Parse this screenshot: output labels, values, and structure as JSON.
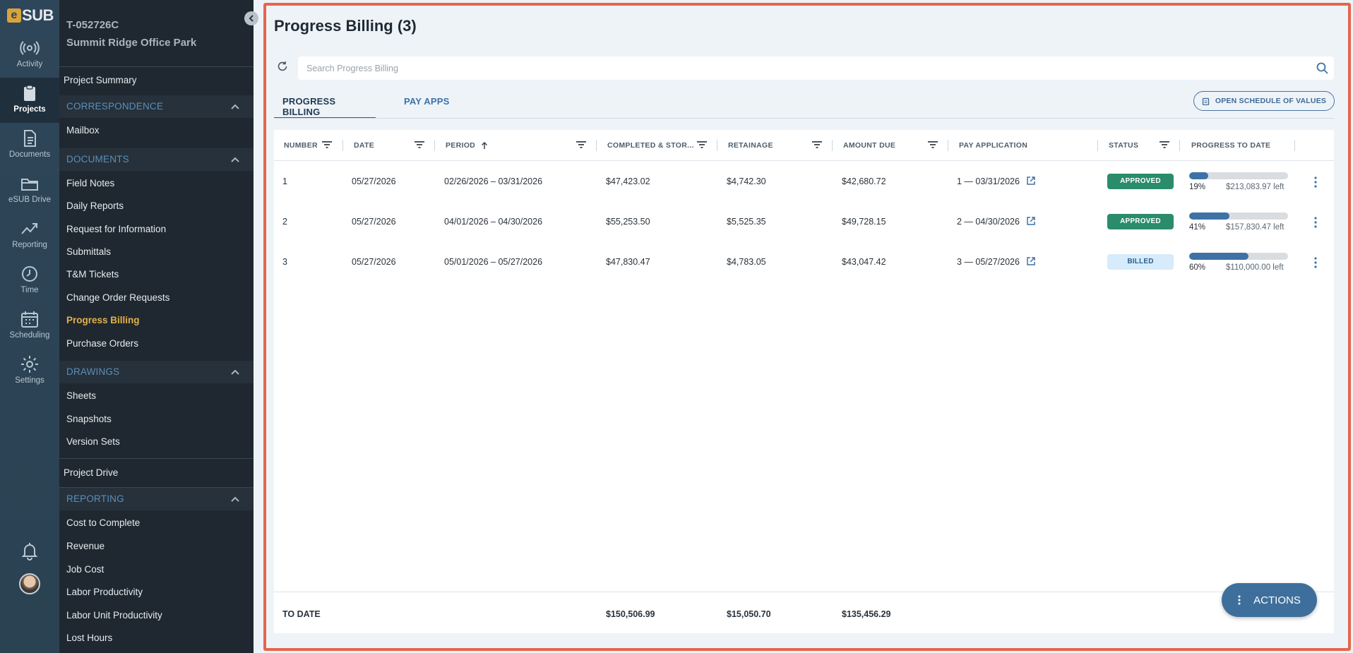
{
  "rail": {
    "logo_text": "SUB",
    "logo_mark": "e",
    "items": [
      {
        "label": "Activity",
        "icon": "activity-icon"
      },
      {
        "label": "Projects",
        "icon": "clipboard-icon"
      },
      {
        "label": "Documents",
        "icon": "document-icon"
      },
      {
        "label": "eSUB Drive",
        "icon": "folder-icon"
      },
      {
        "label": "Reporting",
        "icon": "chart-icon"
      },
      {
        "label": "Time",
        "icon": "clock-icon"
      },
      {
        "label": "Scheduling",
        "icon": "calendar-icon"
      },
      {
        "label": "Settings",
        "icon": "gear-icon"
      }
    ]
  },
  "project": {
    "id": "T-052726C",
    "name": "Summit Ridge Office Park"
  },
  "nav": {
    "project_summary": "Project Summary",
    "correspondence": "CORRESPONDENCE",
    "mailbox": "Mailbox",
    "documents": "DOCUMENTS",
    "doc_items": [
      "Field Notes",
      "Daily Reports",
      "Request for Information",
      "Submittals",
      "T&M Tickets",
      "Change Order Requests",
      "Progress Billing",
      "Purchase Orders"
    ],
    "drawings": "DRAWINGS",
    "drawing_items": [
      "Sheets",
      "Snapshots",
      "Version Sets"
    ],
    "project_drive": "Project Drive",
    "reporting": "REPORTING",
    "report_items": [
      "Cost to Complete",
      "Revenue",
      "Job Cost",
      "Labor Productivity",
      "Labor Unit Productivity",
      "Lost Hours"
    ]
  },
  "page": {
    "title": "Progress Billing (3)",
    "search_placeholder": "Search Progress Billing",
    "tab_progress_billing": "PROGRESS BILLING",
    "tab_pay_apps": "PAY APPS",
    "sov_button": "OPEN SCHEDULE OF VALUES",
    "actions_button": "ACTIONS"
  },
  "table": {
    "headers": {
      "number": "NUMBER",
      "date": "DATE",
      "period": "PERIOD",
      "completed": "COMPLETED & STOR...",
      "retainage": "RETAINAGE",
      "amount_due": "AMOUNT DUE",
      "pay_application": "PAY APPLICATION",
      "status": "STATUS",
      "progress": "PROGRESS TO DATE"
    },
    "rows": [
      {
        "number": "1",
        "date": "05/27/2026",
        "period": "02/26/2026 – 03/31/2026",
        "completed": "$47,423.02",
        "retainage": "$4,742.30",
        "amount_due": "$42,680.72",
        "pay_application": "1 — 03/31/2026",
        "status": "APPROVED",
        "progress_pct": "19%",
        "progress_value": 0.19,
        "left": "$213,083.97 left"
      },
      {
        "number": "2",
        "date": "05/27/2026",
        "period": "04/01/2026 – 04/30/2026",
        "completed": "$55,253.50",
        "retainage": "$5,525.35",
        "amount_due": "$49,728.15",
        "pay_application": "2 — 04/30/2026",
        "status": "APPROVED",
        "progress_pct": "41%",
        "progress_value": 0.41,
        "left": "$157,830.47 left"
      },
      {
        "number": "3",
        "date": "05/27/2026",
        "period": "05/01/2026 – 05/27/2026",
        "completed": "$47,830.47",
        "retainage": "$4,783.05",
        "amount_due": "$43,047.42",
        "pay_application": "3 — 05/27/2026",
        "status": "BILLED",
        "progress_pct": "60%",
        "progress_value": 0.6,
        "left": "$110,000.00 left"
      }
    ],
    "footer": {
      "label": "TO DATE",
      "completed": "$150,506.99",
      "retainage": "$15,050.70",
      "amount_due": "$135,456.29"
    }
  },
  "colors": {
    "approved": "#2a8c6a",
    "billed_bg": "#d6ebfb",
    "active_nav": "#e3b14a",
    "progress_fill": "#3e72a6"
  }
}
